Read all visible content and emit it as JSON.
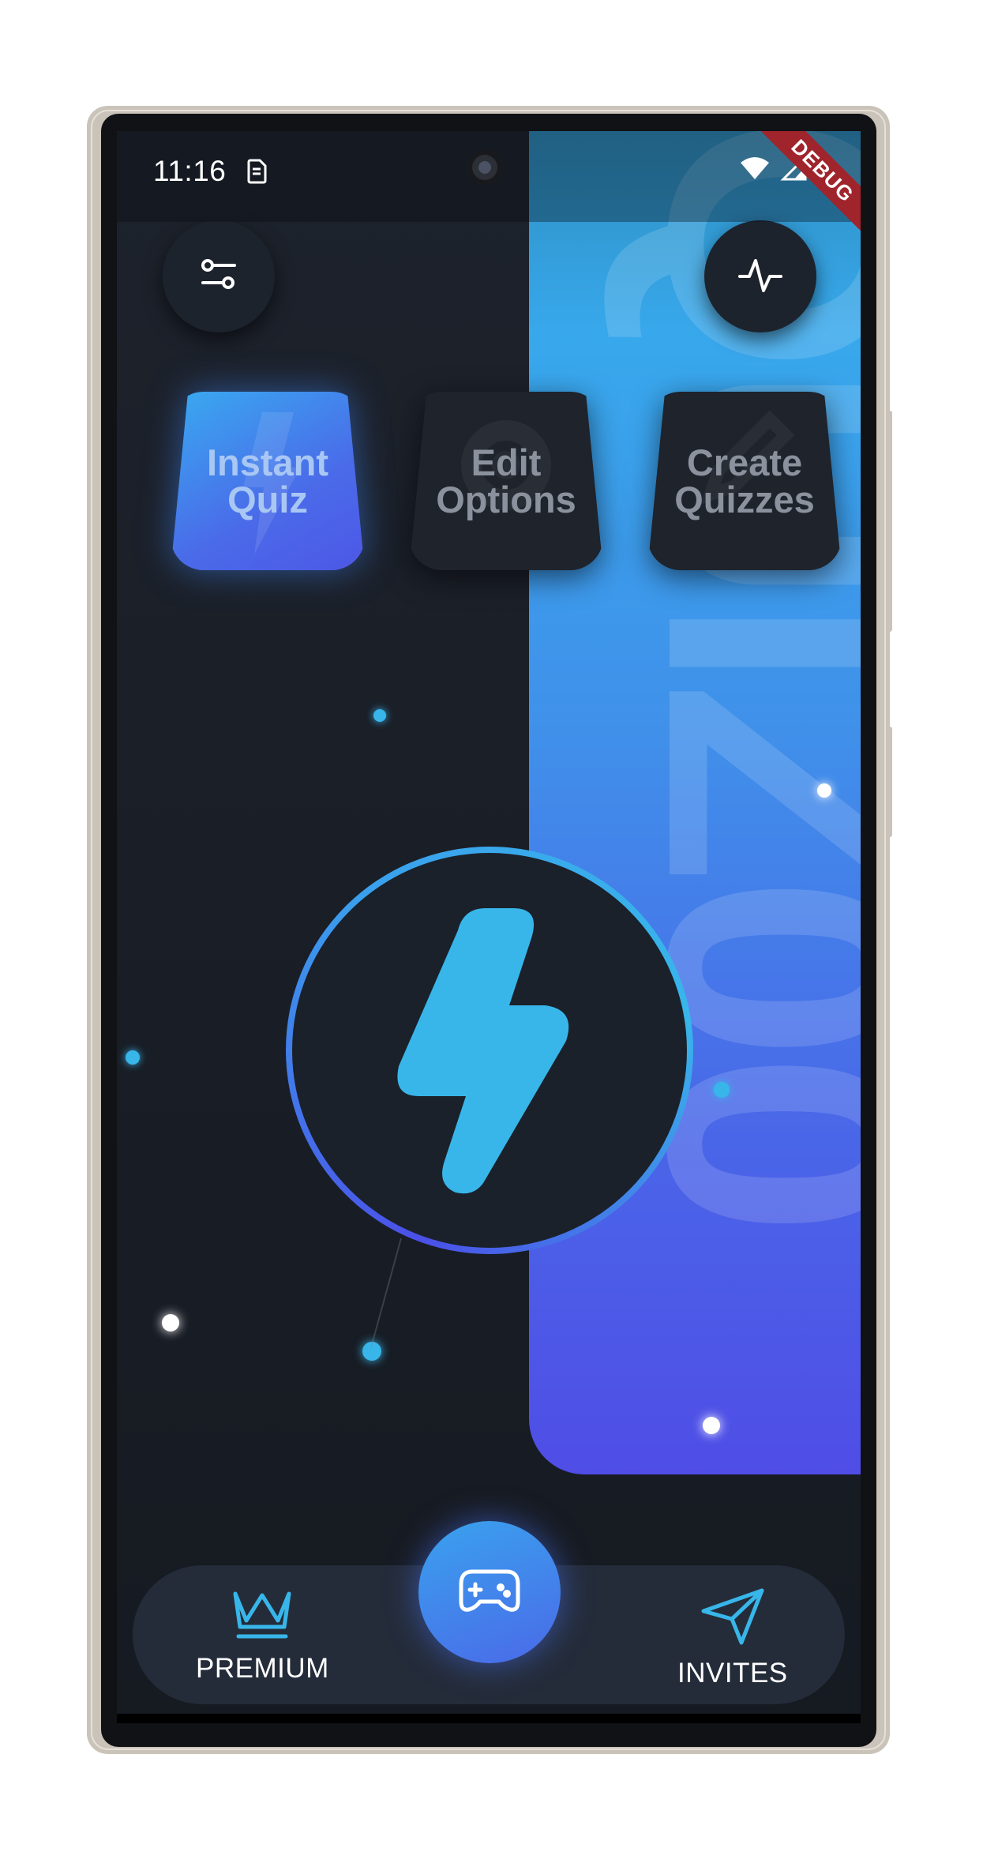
{
  "status_bar": {
    "time": "11:16",
    "debug_label": "DEBUG"
  },
  "background_wordmark": "QUIZ00",
  "top_buttons": {
    "left_icon": "sliders-icon",
    "right_icon": "activity-pulse-icon"
  },
  "tiles": [
    {
      "line1": "Instant",
      "line2": "Quiz",
      "active": true,
      "icon": "lightning-icon"
    },
    {
      "line1": "Edit",
      "line2": "Options",
      "active": false,
      "icon": "gear-icon"
    },
    {
      "line1": "Create",
      "line2": "Quizzes",
      "active": false,
      "icon": "pencil-icon"
    }
  ],
  "center_button": {
    "icon": "lightning-bolt-icon"
  },
  "bottom_nav": {
    "left_label": "PREMIUM",
    "left_icon": "crown-icon",
    "center_icon": "gamepad-icon",
    "right_label": "INVITES",
    "right_icon": "send-icon"
  },
  "colors": {
    "accent_cyan": "#38b6ea",
    "accent_indigo": "#4b50e8",
    "screen_bg": "#1a1f28"
  }
}
